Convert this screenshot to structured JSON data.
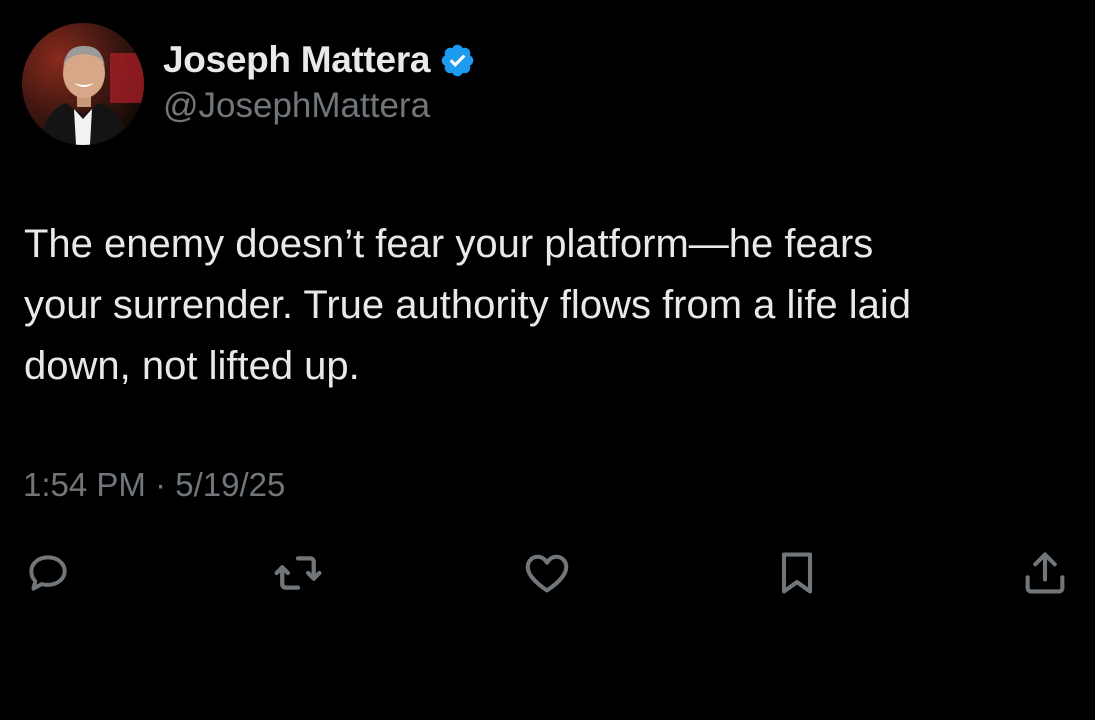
{
  "author": {
    "display_name": "Joseph Mattera",
    "handle": "@JosephMattera",
    "verified": true,
    "avatar_icon": "profile-photo"
  },
  "tweet": {
    "text": "The enemy doesn’t fear your platform—he fears\nyour surrender. True authority flows from a life laid\ndown, not lifted up.",
    "timestamp": "1:54 PM · 5/19/25"
  },
  "actions": [
    {
      "name": "reply",
      "icon": "speech-bubble-icon"
    },
    {
      "name": "repost",
      "icon": "repost-arrows-icon"
    },
    {
      "name": "like",
      "icon": "heart-icon"
    },
    {
      "name": "bookmark",
      "icon": "bookmark-icon"
    },
    {
      "name": "share",
      "icon": "share-icon"
    }
  ],
  "colors": {
    "background": "#000000",
    "text": "#e7e9ea",
    "secondary": "#71767b",
    "verified_blue": "#1d9bf0"
  }
}
